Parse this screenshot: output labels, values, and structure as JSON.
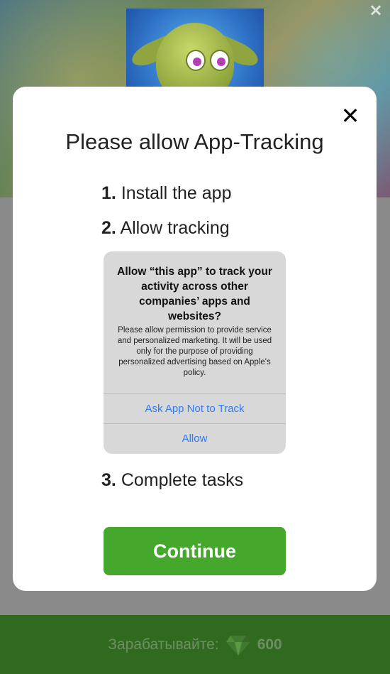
{
  "background": {
    "close_symbol": "×",
    "footer": {
      "label": "Зарабатывайте:",
      "icon": "gem-icon",
      "value": "600"
    }
  },
  "modal": {
    "close_symbol": "✕",
    "title": "Please allow App-Tracking",
    "steps": [
      {
        "number": "1.",
        "text": "Install the app"
      },
      {
        "number": "2.",
        "text": "Allow tracking"
      },
      {
        "number": "3.",
        "text": "Complete tasks"
      }
    ],
    "ios_prompt": {
      "title": "Allow “this app” to track your activity across other companies’ apps and websites?",
      "message": "Please allow permission to provide service and personalized marketing. It will be used only for the purpose of providing personalized advertising based on Apple's policy.",
      "deny_label": "Ask App Not to Track",
      "allow_label": "Allow"
    },
    "continue_label": "Continue"
  },
  "colors": {
    "continue": "#45a72c",
    "ios_link": "#2f7cf6",
    "footer": "#2f6a1f"
  }
}
